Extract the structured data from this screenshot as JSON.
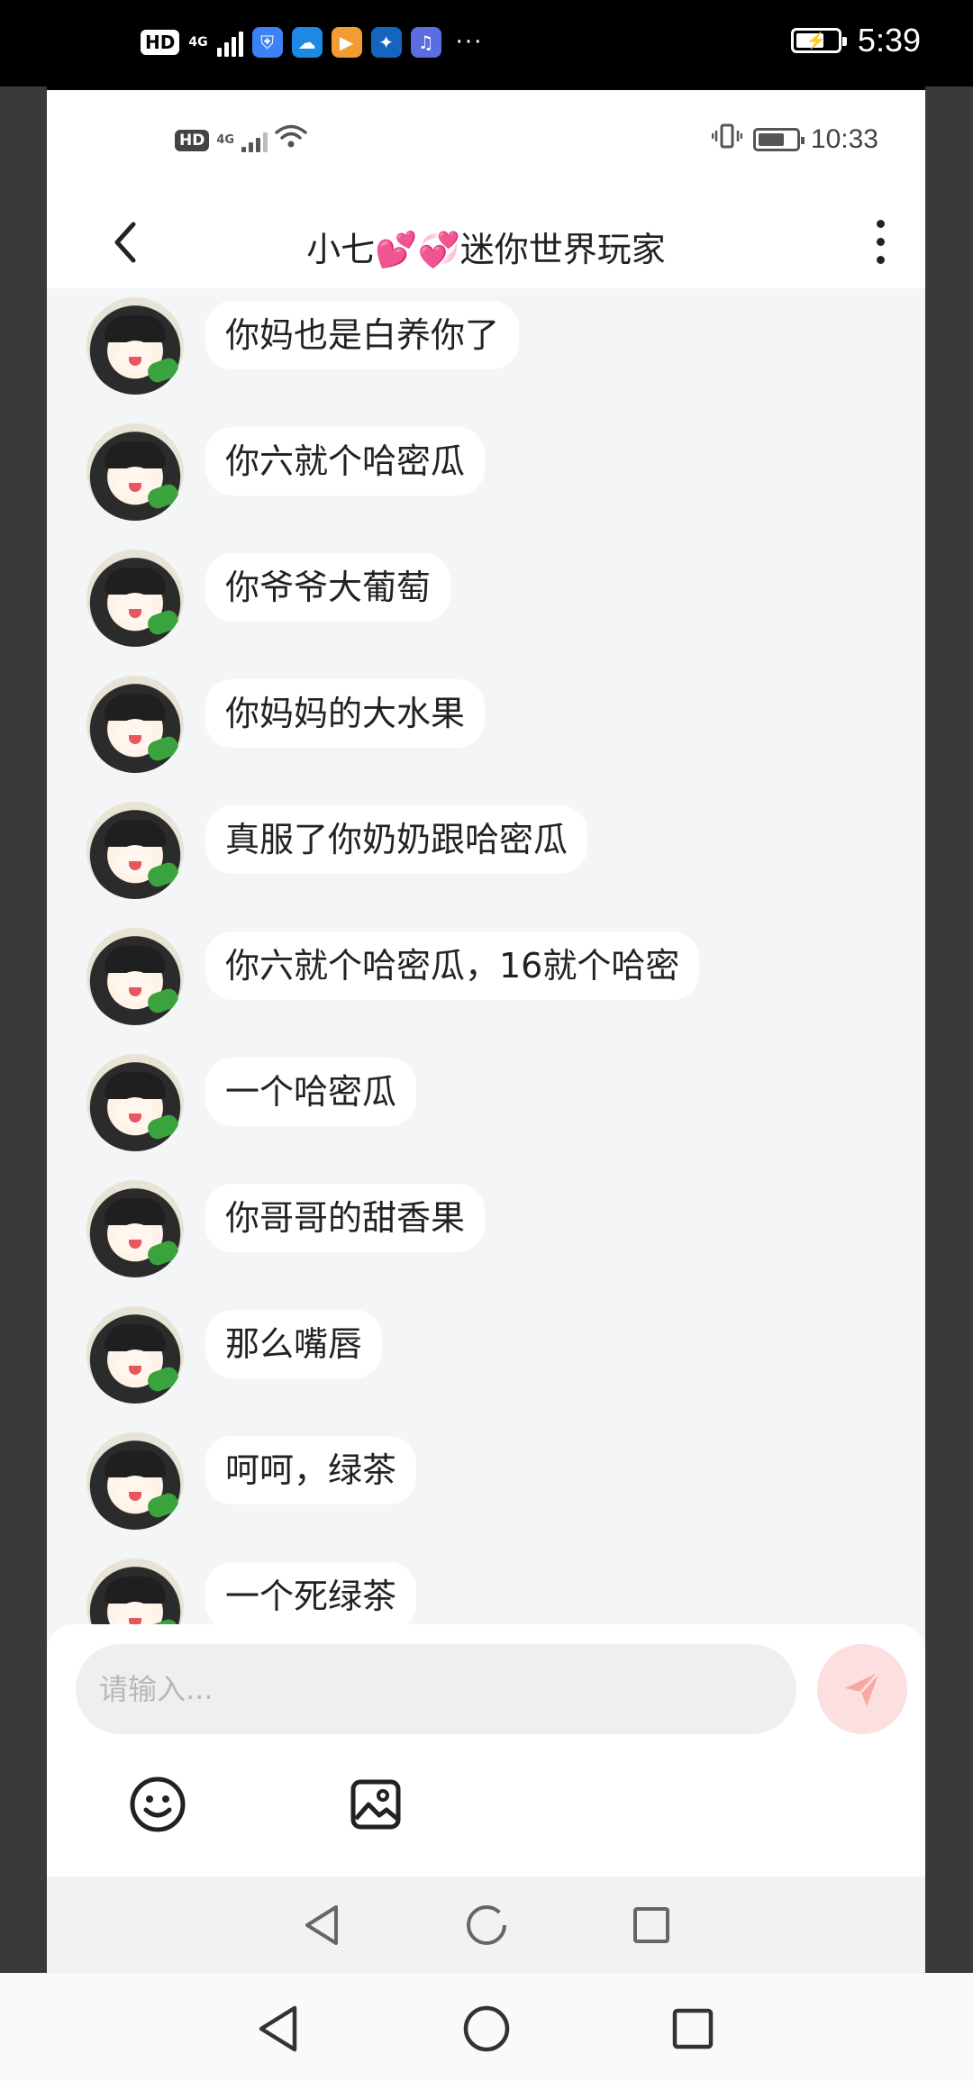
{
  "host_status": {
    "hd_label": "HD",
    "network_label": "4G",
    "dots": "···",
    "time": "5:39"
  },
  "inner_status": {
    "hd_label": "HD",
    "network_label": "4G",
    "time": "10:33"
  },
  "header": {
    "title": "小七💕💞迷你世界玩家"
  },
  "messages": [
    {
      "text": "你妈也是白养你了"
    },
    {
      "text": "你六就个哈密瓜"
    },
    {
      "text": "你爷爷大葡萄"
    },
    {
      "text": "你妈妈的大水果"
    },
    {
      "text": "真服了你奶奶跟哈密瓜"
    },
    {
      "text": "你六就个哈密瓜，16就个哈密"
    },
    {
      "text": "一个哈密瓜"
    },
    {
      "text": "你哥哥的甜香果"
    },
    {
      "text": "那么嘴唇"
    },
    {
      "text": "呵呵，绿茶"
    },
    {
      "text": "一个死绿茶"
    }
  ],
  "composer": {
    "placeholder": "请输入..."
  },
  "colors": {
    "send_button_bg": "#fbe0df",
    "send_icon": "#f7a8a4",
    "chat_bg": "#f4f5f7"
  },
  "icons": {
    "back": "chevron-left-icon",
    "more": "more-vertical-icon",
    "send": "send-icon",
    "emoji": "emoji-icon",
    "image": "image-icon"
  }
}
